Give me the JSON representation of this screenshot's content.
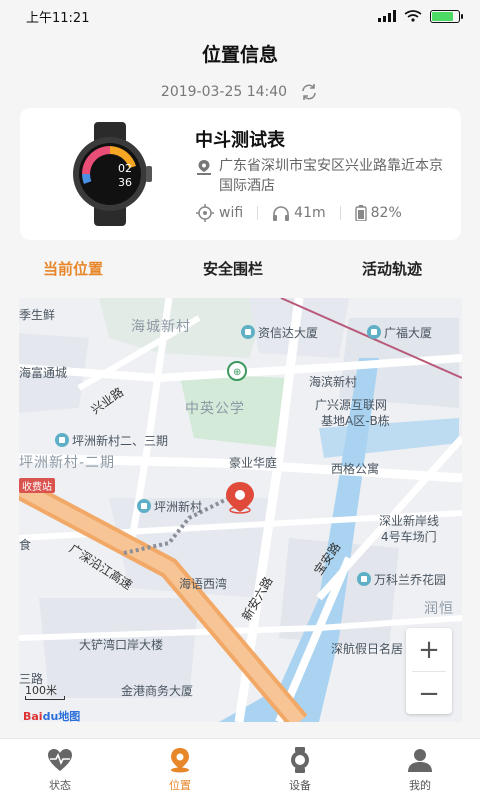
{
  "status_bar": {
    "time": "上午11:21"
  },
  "header": {
    "title": "位置信息",
    "timestamp": "2019-03-25 14:40"
  },
  "device": {
    "name": "中斗测试表",
    "address": "广东省深圳市宝安区兴业路靠近本京国际酒店",
    "network": "wifi",
    "accuracy": "41m",
    "battery": "82%",
    "battery_level": 0.82,
    "watch_time_top": "02",
    "watch_time_bottom": "36"
  },
  "tabs": [
    {
      "label": "当前位置",
      "active": true
    },
    {
      "label": "安全围栏",
      "active": false
    },
    {
      "label": "活动轨迹",
      "active": false
    }
  ],
  "map": {
    "labels": {
      "l1": "季生鲜",
      "l2": "海城新村",
      "l3": "资信达大厦",
      "l4": "广福大厦",
      "l5": "海富通城",
      "l6": "兴业路",
      "l7": "海滨新村",
      "l8": "中英公学",
      "l9": "广兴源互联网",
      "l10": "基地A区-B栋",
      "l11": "坪洲新村二、三期",
      "l12": "坪洲新村-二期",
      "l13": "豪业华庭",
      "l14": "西格公寓",
      "l15": "收费站",
      "l16": "坪洲新村",
      "l17": "深业新岸线",
      "l18": "4号车场门",
      "l19": "广深沿江高速",
      "l20": "宝安路",
      "l21": "海语西湾",
      "l22": "万科兰乔花园",
      "l23": "新安六路",
      "l24": "润恒",
      "l25": "大铲湾口岸大楼",
      "l26": "深航假日名居",
      "l27": "金港商务大厦",
      "l28": "三路",
      "l29": "食"
    },
    "zoom_in": "+",
    "zoom_out": "−",
    "scale": "100米",
    "provider_a": "Bai",
    "provider_b": "du地图"
  },
  "bottom_nav": [
    {
      "label": "状态",
      "icon": "heart-pulse-icon",
      "active": false
    },
    {
      "label": "位置",
      "icon": "location-pin-icon",
      "active": true
    },
    {
      "label": "设备",
      "icon": "watch-icon",
      "active": false
    },
    {
      "label": "我的",
      "icon": "user-icon",
      "active": false
    }
  ],
  "colors": {
    "accent": "#e8862a",
    "water": "#a9d3f0",
    "highway": "#f2a967",
    "poi": "#5fb0c6",
    "green": "#d3ead8"
  }
}
